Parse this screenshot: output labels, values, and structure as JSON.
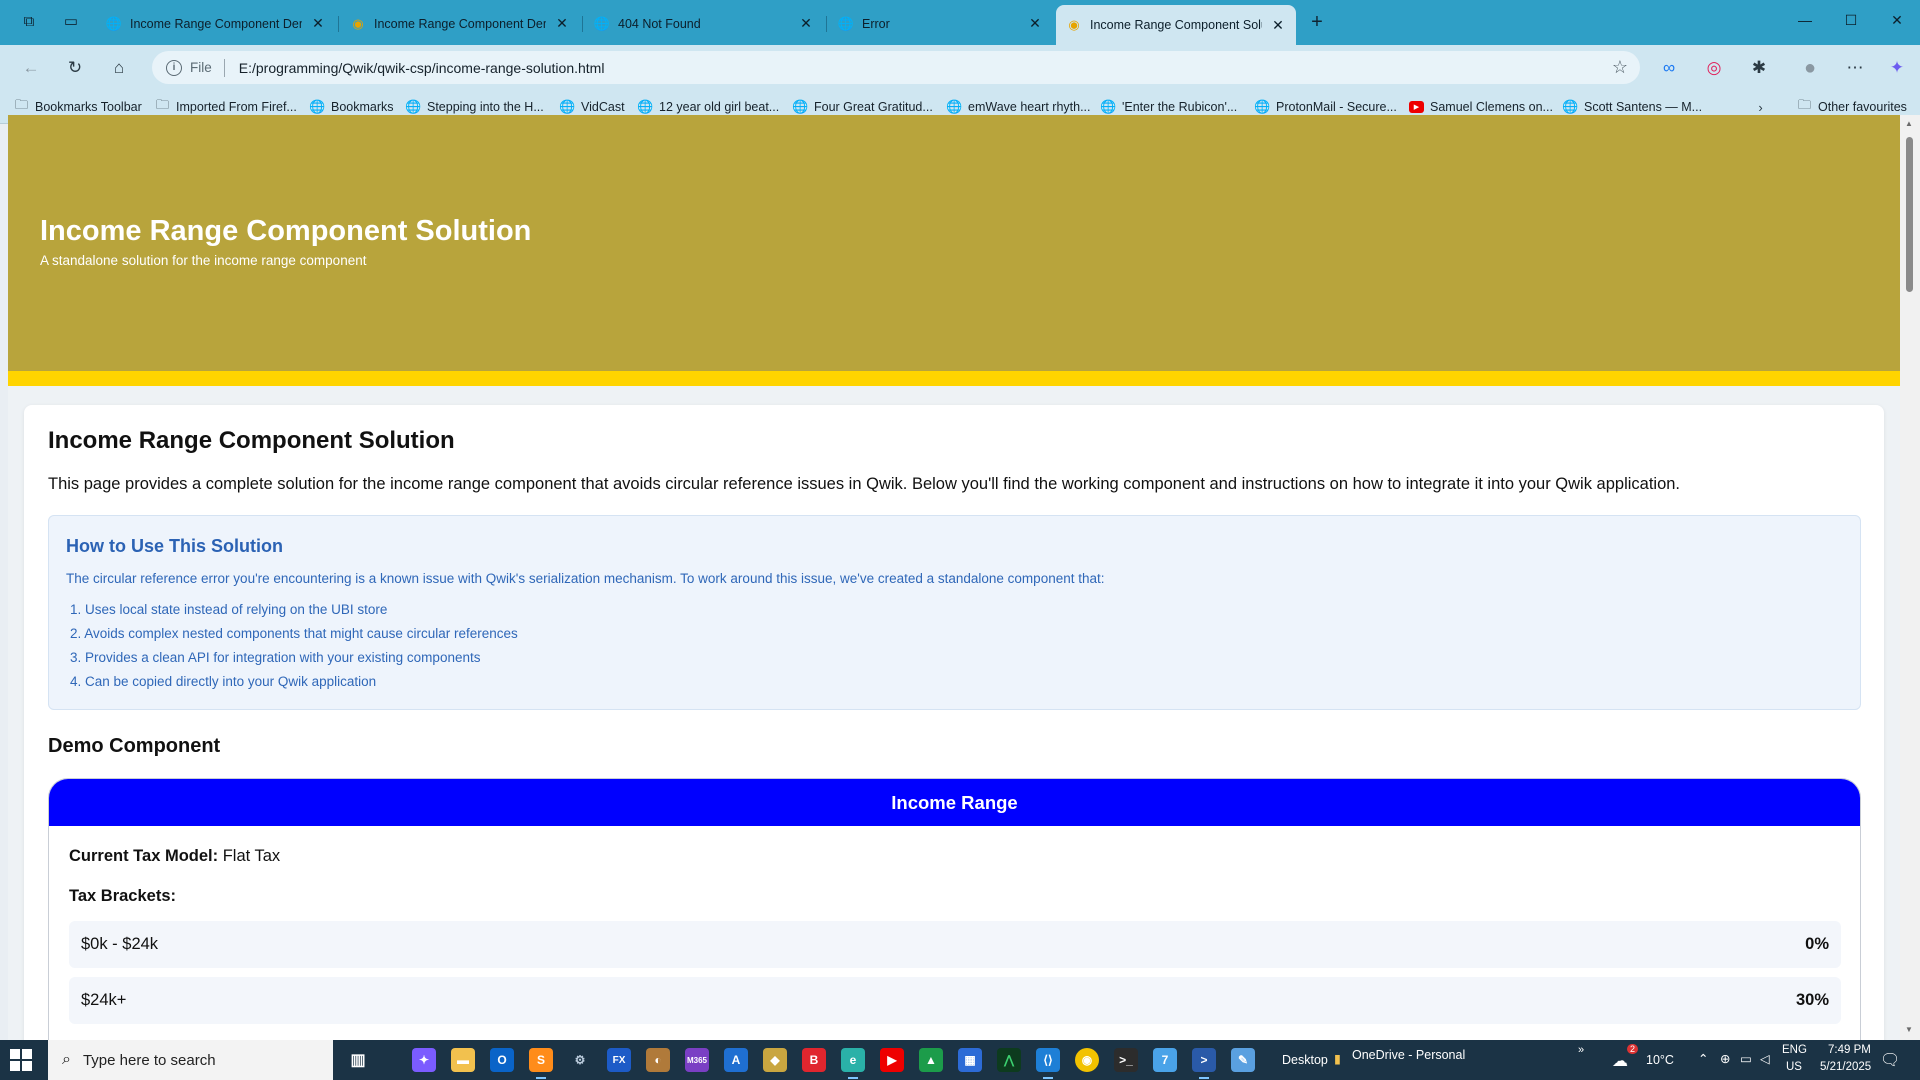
{
  "browser": {
    "tabs": [
      {
        "title": "Income Range Component Demo",
        "icon": "globe-icon",
        "active": false
      },
      {
        "title": "Income Range Component Demo",
        "icon": "qwik-icon",
        "active": false
      },
      {
        "title": "404 Not Found",
        "icon": "globe-icon",
        "active": false
      },
      {
        "title": "Error",
        "icon": "globe-icon",
        "active": false
      },
      {
        "title": "Income Range Component Soluti",
        "icon": "qwik-icon",
        "active": true
      }
    ],
    "address": {
      "scheme": "File",
      "url": "E:/programming/Qwik/qwik-csp/income-range-solution.html"
    },
    "bookmarks": [
      {
        "label": "Bookmarks Toolbar",
        "icon": "folder-icon"
      },
      {
        "label": "Imported From Firef...",
        "icon": "folder-icon"
      },
      {
        "label": "Bookmarks",
        "icon": "globe-icon"
      },
      {
        "label": "Stepping into the H...",
        "icon": "globe-icon"
      },
      {
        "label": "VidCast",
        "icon": "globe-icon"
      },
      {
        "label": "12 year old girl beat...",
        "icon": "globe-icon"
      },
      {
        "label": "Four Great Gratitud...",
        "icon": "globe-icon"
      },
      {
        "label": "emWave heart rhyth...",
        "icon": "globe-icon"
      },
      {
        "label": "'Enter the Rubicon'...",
        "icon": "globe-icon"
      },
      {
        "label": "ProtonMail - Secure...",
        "icon": "globe-icon"
      },
      {
        "label": "Samuel Clemens on...",
        "icon": "youtube-icon"
      },
      {
        "label": "Scott Santens — M...",
        "icon": "globe-icon"
      }
    ],
    "other_favourites": "Other favourites"
  },
  "page": {
    "hero": {
      "title": "Income Range Component Solution",
      "subtitle": "A standalone solution for the income range component",
      "bg_color": "#b8a43c",
      "stripe_color": "#ffd400"
    },
    "heading": "Income Range Component Solution",
    "intro": "This page provides a complete solution for the income range component that avoids circular reference issues in Qwik. Below you'll find the working component and instructions on how to integrate it into your Qwik application.",
    "howto": {
      "title": "How to Use This Solution",
      "description": "The circular reference error you're encountering is a known issue with Qwik's serialization mechanism. To work around this issue, we've created a standalone component that:",
      "items": [
        "1. Uses local state instead of relying on the UBI store",
        "2. Avoids complex nested components that might cause circular references",
        "3. Provides a clean API for integration with your existing components",
        "4. Can be copied directly into your Qwik application"
      ]
    },
    "demo": {
      "heading": "Demo Component",
      "widget_title": "Income Range",
      "header_color": "#0000ff",
      "tax_model_label": "Current Tax Model:",
      "tax_model_value": "Flat Tax",
      "brackets_label": "Tax Brackets:",
      "brackets": [
        {
          "range": "$0k - $24k",
          "rate": "0%"
        },
        {
          "range": "$24k+",
          "rate": "30%"
        }
      ]
    }
  },
  "taskbar": {
    "search_placeholder": "Type here to search",
    "desktop_label": "Desktop",
    "onedrive_label": "OneDrive - Personal",
    "weather": "10°C",
    "weather_badge": "2",
    "lang_top": "ENG",
    "lang_bottom": "US",
    "time": "7:49 PM",
    "date": "5/21/2025"
  }
}
